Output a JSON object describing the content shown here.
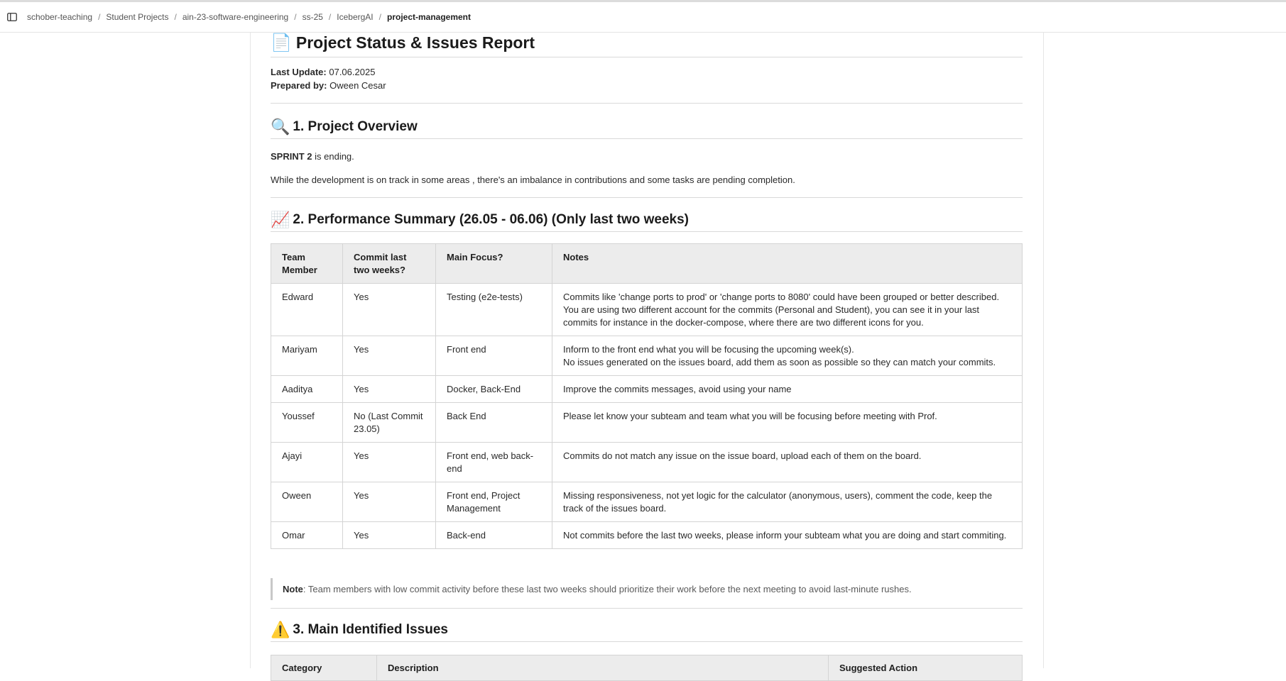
{
  "breadcrumb": {
    "items": [
      "schober-teaching",
      "Student Projects",
      "ain-23-software-engineering",
      "ss-25",
      "IcebergAI"
    ],
    "current": "project-management",
    "separator": "/"
  },
  "doc": {
    "title_icon": "📄",
    "title": "Project Status & Issues Report",
    "last_update_label": "Last Update:",
    "last_update_value": "07.06.2025",
    "prepared_by_label": "Prepared by:",
    "prepared_by_value": "Oween Cesar"
  },
  "section1": {
    "icon": "🔍",
    "title": "1. Project Overview",
    "sprint_bold": "SPRINT 2",
    "sprint_rest": " is ending.",
    "paragraph": "While the development is on track in some areas , there's an imbalance in contributions and some tasks are pending completion."
  },
  "section2": {
    "icon": "📈",
    "title": "2. Performance Summary (26.05 - 06.06) (Only last two weeks)",
    "headers": [
      "Team Member",
      "Commit last two weeks?",
      "Main Focus?",
      "Notes"
    ],
    "rows": [
      {
        "member": "Edward",
        "commit": "Yes",
        "focus": "Testing (e2e-tests)",
        "notes": [
          "Commits like 'change ports to prod' or 'change ports to 8080' could have been grouped or better described.",
          "You are using two different account for the commits (Personal and Student), you can see it in your last commits for instance in the docker-compose, where there are two different icons for you."
        ]
      },
      {
        "member": "Mariyam",
        "commit": "Yes",
        "focus": "Front end",
        "notes": [
          "Inform to the front end what you will be focusing the upcoming week(s).",
          "No issues generated on the issues board, add them as soon as possible so they can match your commits."
        ]
      },
      {
        "member": "Aaditya",
        "commit": "Yes",
        "focus": "Docker, Back-End",
        "notes": [
          "Improve the commits messages, avoid using your name"
        ]
      },
      {
        "member": "Youssef",
        "commit": "No (Last Commit 23.05)",
        "focus": "Back End",
        "notes": [
          "Please let know your subteam and team what you will be focusing before meeting with Prof."
        ]
      },
      {
        "member": "Ajayi",
        "commit": "Yes",
        "focus": "Front end, web back-end",
        "notes": [
          "Commits do not match any issue on the issue board, upload each of them on the board."
        ]
      },
      {
        "member": "Oween",
        "commit": "Yes",
        "focus": "Front end, Project Management",
        "notes": [
          "Missing responsiveness, not yet logic for the calculator (anonymous, users), comment the code, keep the track of the issues board."
        ]
      },
      {
        "member": "Omar",
        "commit": "Yes",
        "focus": "Back-end",
        "notes": [
          "Not commits before the last two weeks, please inform your subteam what you are doing and start commiting."
        ]
      }
    ],
    "note_label": "Note",
    "note_text": ": Team members with low commit activity before these last two weeks should prioritize their work before the next meeting to avoid last-minute rushes."
  },
  "section3": {
    "icon": "⚠️",
    "title": "3. Main Identified Issues",
    "headers": [
      "Category",
      "Description",
      "Suggested Action"
    ]
  }
}
